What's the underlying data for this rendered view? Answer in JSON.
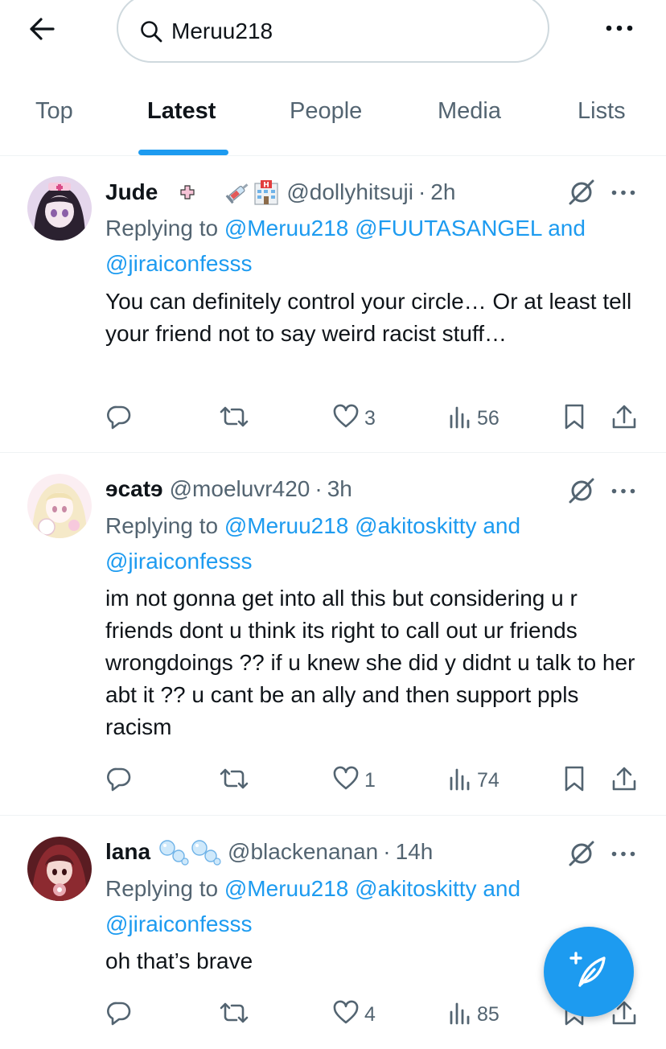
{
  "search": {
    "query": "Meruu218"
  },
  "tabs": [
    {
      "label": "Top"
    },
    {
      "label": "Latest"
    },
    {
      "label": "People"
    },
    {
      "label": "Media"
    },
    {
      "label": "Lists"
    }
  ],
  "active_tab": "Latest",
  "colors": {
    "accent": "#1d9bf0",
    "text": "#0f1419",
    "muted": "#536471",
    "divider": "#eff3f4"
  },
  "tweets": [
    {
      "name": "Jude",
      "handle": "@dollyhitsuji",
      "dot": "·",
      "time": "2h",
      "name_emojis": [
        "pink-plus-icon",
        "syringe-emoji",
        "hospital-emoji"
      ],
      "replying_prefix": "Replying to",
      "mentions": [
        "@Meruu218",
        "@FUUTASANGEL"
      ],
      "and_text": "and",
      "last_mention": "@jiraiconfesss",
      "text": "You can definitely control your circle… Or at least tell your friend not to say weird racist stuff…",
      "replies": "",
      "retweets": "",
      "likes": "3",
      "views": "56"
    },
    {
      "name": "ɘcatɘ",
      "handle": "@moeluvr420",
      "dot": "·",
      "time": "3h",
      "name_emojis": [],
      "replying_prefix": "Replying to",
      "mentions": [
        "@Meruu218",
        "@akitoskitty"
      ],
      "and_text": "and",
      "last_mention": "@jiraiconfesss",
      "text": "im not gonna get into all this but considering u r friends dont u think its right to call out ur friends wrongdoings  ?? if u knew she did y didnt u talk to her abt it  ?? u cant be an ally and then support ppls racism",
      "replies": "",
      "retweets": "",
      "likes": "1",
      "views": "74"
    },
    {
      "name": "lana",
      "handle": "@blackenanan",
      "dot": "·",
      "time": "14h",
      "name_emojis": [
        "bubbles-emoji",
        "bubbles-emoji"
      ],
      "replying_prefix": "Replying to",
      "mentions": [
        "@Meruu218",
        "@akitoskitty"
      ],
      "and_text": "and",
      "last_mention": "@jiraiconfesss",
      "text": "oh that’s brave",
      "replies": "",
      "retweets": "",
      "likes": "4",
      "views": "85"
    }
  ]
}
